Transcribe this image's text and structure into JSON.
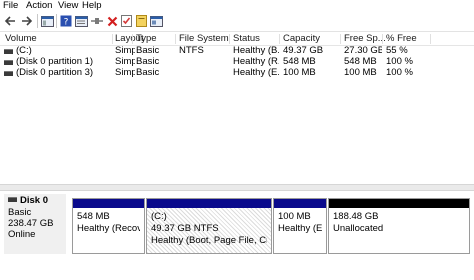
{
  "menu": [
    "File",
    "Action",
    "View",
    "Help"
  ],
  "toolbar": {
    "buttons": [
      "back-arrow-icon",
      "forward-arrow-icon",
      "console-tree-icon",
      "help-icon",
      "properties-icon",
      "connect-icon",
      "delete-icon",
      "check-icon",
      "new-icon",
      "rescan-icon"
    ]
  },
  "volume_list": {
    "columns": [
      "Volume",
      "Layout",
      "Type",
      "File System",
      "Status",
      "Capacity",
      "Free Sp...",
      "% Free"
    ],
    "rows": [
      [
        "(C:)",
        "Simple",
        "Basic",
        "NTFS",
        "Healthy (B...",
        "49.37 GB",
        "27.30 GB",
        "55 %"
      ],
      [
        "(Disk 0 partition 1)",
        "Simple",
        "Basic",
        "",
        "Healthy (R...",
        "548 MB",
        "548 MB",
        "100 %"
      ],
      [
        "(Disk 0 partition 3)",
        "Simple",
        "Basic",
        "",
        "Healthy (E...",
        "100 MB",
        "100 MB",
        "100 %"
      ]
    ]
  },
  "disk": {
    "name": "Disk 0",
    "type": "Basic",
    "size": "238.47 GB",
    "status": "Online",
    "partitions": [
      {
        "label": "",
        "size": "548 MB",
        "status": "Healthy (Recovery",
        "band_color": "#0a0a8c",
        "selected": false
      },
      {
        "label": "(C:)",
        "size": "49.37 GB NTFS",
        "status": "Healthy (Boot, Page File, Crash Dur",
        "band_color": "#0a0a8c",
        "selected": true
      },
      {
        "label": "",
        "size": "100 MB",
        "status": "Healthy (EFI S",
        "band_color": "#0a0a8c",
        "selected": false
      },
      {
        "label": "",
        "size": "188.48 GB",
        "status": "Unallocated",
        "band_color": "#000000",
        "selected": false
      }
    ]
  }
}
